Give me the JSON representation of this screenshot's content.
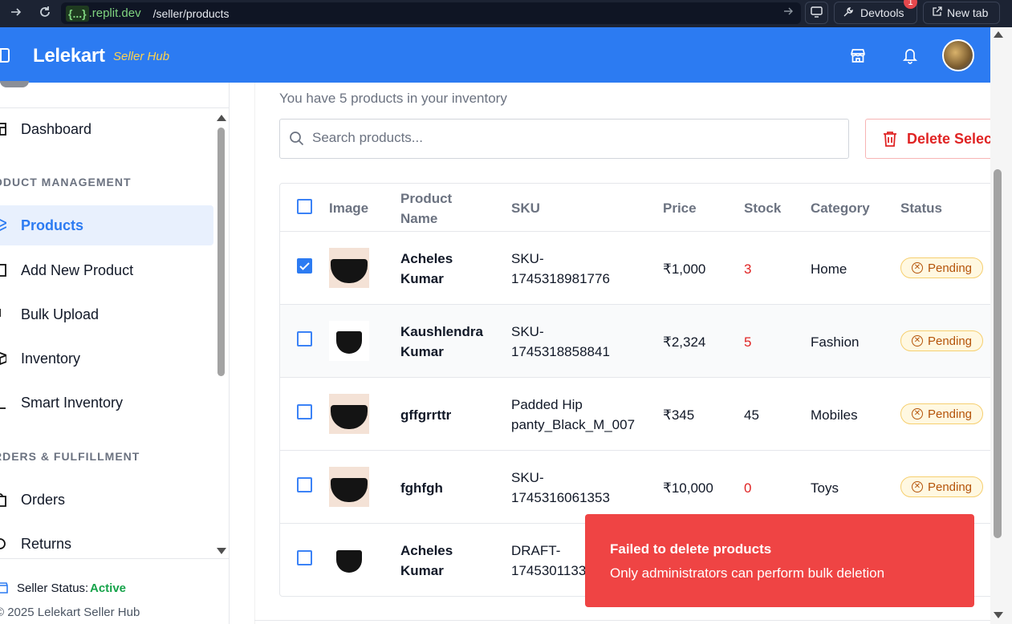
{
  "browser": {
    "url_domain_tag": "{...}",
    "url_domain": ".replit.dev",
    "url_path": "/seller/products",
    "devtools_label": "Devtools",
    "devtools_badge": "1",
    "newtab_label": "New tab"
  },
  "header": {
    "brand": "Lelekart",
    "brand_sub": "Seller Hub"
  },
  "sidebar": {
    "dashboard": "Dashboard",
    "section_product": "ODUCT MANAGEMENT",
    "products": "Products",
    "add_new": "Add New Product",
    "bulk_upload": "Bulk Upload",
    "inventory": "Inventory",
    "smart_inventory": "Smart Inventory",
    "section_orders": "RDERS & FULFILLMENT",
    "orders": "Orders",
    "returns": "Returns",
    "seller_status_label": "Seller Status:",
    "seller_status_value": "Active",
    "copyright": "© 2025 Lelekart Seller Hub"
  },
  "main": {
    "inventory_text": "You have 5 products in your inventory",
    "search_placeholder": "Search products...",
    "delete_selected": "Delete Selected"
  },
  "table": {
    "headers": {
      "image": "Image",
      "name_1": "Product",
      "name_2": "Name",
      "sku": "SKU",
      "price": "Price",
      "stock": "Stock",
      "category": "Category",
      "status": "Status"
    },
    "rows": [
      {
        "name_1": "Acheles",
        "name_2": "Kumar",
        "sku_1": "SKU-",
        "sku_2": "1745318981776",
        "price": "₹1,000",
        "stock": "3",
        "category": "Home",
        "status": "Pending",
        "checked": true
      },
      {
        "name_1": "Kaushlendra",
        "name_2": "Kumar",
        "sku_1": "SKU-",
        "sku_2": "1745318858841",
        "price": "₹2,324",
        "stock": "5",
        "category": "Fashion",
        "status": "Pending",
        "checked": false
      },
      {
        "name_1": "gffgrrttr",
        "name_2": "",
        "sku_1": "Padded Hip",
        "sku_2": "panty_Black_M_007",
        "price": "₹345",
        "stock": "45",
        "category": "Mobiles",
        "status": "Pending",
        "checked": false
      },
      {
        "name_1": "fghfgh",
        "name_2": "",
        "sku_1": "SKU-",
        "sku_2": "1745316061353",
        "price": "₹10,000",
        "stock": "0",
        "category": "Toys",
        "status": "Pending",
        "checked": false
      },
      {
        "name_1": "Acheles",
        "name_2": "Kumar",
        "sku_1": "DRAFT-",
        "sku_2": "1745301133",
        "price": "",
        "stock": "",
        "category": "",
        "status": "",
        "checked": false
      }
    ]
  },
  "toast": {
    "title": "Failed to delete products",
    "message": "Only administrators can perform bulk deletion"
  },
  "colors": {
    "brand": "#2c7bf2",
    "brand_sub": "#ffd34d",
    "danger": "#ef4444",
    "pending": "#b45309",
    "active": "#16a34a"
  }
}
